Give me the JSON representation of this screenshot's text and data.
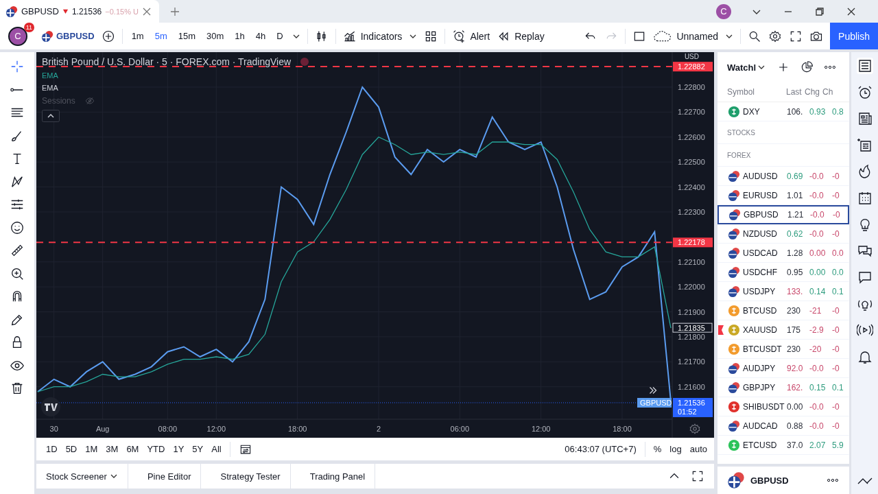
{
  "browser": {
    "tab": {
      "symbol": "GBPUSD",
      "price": "1.21536",
      "change": "−0.15% U"
    },
    "avatar": "C"
  },
  "toolbar": {
    "avatar": "C",
    "badge": "11",
    "symbol": "GBPUSD",
    "intervals": [
      {
        "label": "1m",
        "selected": false
      },
      {
        "label": "5m",
        "selected": true
      },
      {
        "label": "15m",
        "selected": false
      },
      {
        "label": "30m",
        "selected": false
      },
      {
        "label": "1h",
        "selected": false
      },
      {
        "label": "4h",
        "selected": false
      },
      {
        "label": "D",
        "selected": false
      }
    ],
    "indicators": "Indicators",
    "alert": "Alert",
    "replay": "Replay",
    "layout": "Unnamed",
    "publish": "Publish"
  },
  "chart": {
    "title": "British Pound / U.S. Dollar · 5 · FOREX.com · TradingView",
    "studies": [
      "EMA"
    ],
    "sessions": "Sessions",
    "currency": "USD",
    "chart_data": {
      "type": "line",
      "categories": [
        null,
        "30",
        null,
        null,
        "Aug",
        null,
        null,
        null,
        "08:00",
        null,
        null,
        "12:00",
        null,
        null,
        null,
        null,
        "18:00",
        null,
        null,
        null,
        null,
        "2",
        null,
        null,
        null,
        null,
        "06:00",
        null,
        null,
        null,
        null,
        "12:00",
        null,
        null,
        null,
        null,
        "18:00",
        null,
        null,
        null
      ],
      "grid": true,
      "series": [
        {
          "name": "GBPUSD",
          "color": "#5b9cf0",
          "values": [
            1.2158,
            1.2163,
            1.216,
            1.2166,
            1.217,
            1.2163,
            1.2165,
            1.2168,
            1.2174,
            1.2176,
            1.2172,
            1.2175,
            1.217,
            1.2178,
            1.2195,
            1.224,
            1.2235,
            1.2225,
            1.2245,
            1.2262,
            1.228,
            1.2272,
            1.2252,
            1.2245,
            1.2255,
            1.225,
            1.2255,
            1.2252,
            1.2268,
            1.2258,
            1.2255,
            1.2258,
            1.224,
            1.2215,
            1.2195,
            1.2198,
            1.2208,
            1.2212,
            1.2222,
            1.2154
          ]
        },
        {
          "name": "EMA",
          "color": "#26a69a",
          "values": [
            1.2158,
            1.216,
            1.216,
            1.2162,
            1.2165,
            1.2164,
            1.2164,
            1.2166,
            1.2169,
            1.2171,
            1.2171,
            1.2172,
            1.2171,
            1.2173,
            1.2181,
            1.2202,
            1.2214,
            1.2218,
            1.2227,
            1.2239,
            1.2253,
            1.226,
            1.2257,
            1.2253,
            1.2254,
            1.2253,
            1.2254,
            1.2253,
            1.2258,
            1.2258,
            1.2257,
            1.2257,
            1.2251,
            1.2238,
            1.2223,
            1.2214,
            1.2212,
            1.2212,
            1.2216,
            1.21835
          ]
        }
      ],
      "ylim": [
        1.2147,
        1.2294
      ],
      "yticks": [
        {
          "value": 1.216,
          "label": "1.21600"
        },
        {
          "value": 1.217,
          "label": "1.21700"
        },
        {
          "value": 1.218,
          "label": "1.21800"
        },
        {
          "value": 1.219,
          "label": "1.21900"
        },
        {
          "value": 1.22,
          "label": "1.22000"
        },
        {
          "value": 1.221,
          "label": "1.22100"
        },
        {
          "value": 1.223,
          "label": "1.22300"
        },
        {
          "value": 1.224,
          "label": "1.22400"
        },
        {
          "value": 1.225,
          "label": "1.22500"
        },
        {
          "value": 1.226,
          "label": "1.22600"
        },
        {
          "value": 1.227,
          "label": "1.22700"
        },
        {
          "value": 1.228,
          "label": "1.22800"
        }
      ],
      "ref_lines": [
        {
          "axis": "y",
          "value": 1.22882,
          "label": "1.22882",
          "color": "#f23645"
        },
        {
          "axis": "y",
          "value": 1.22178,
          "label": "1.22178",
          "color": "#f23645"
        },
        {
          "axis": "y",
          "value": 1.21536,
          "label": "1.21536",
          "color": "#2962ff"
        }
      ],
      "annotations": [
        "1.21835",
        "01:52"
      ]
    }
  },
  "ranges": [
    "1D",
    "5D",
    "1M",
    "3M",
    "6M",
    "YTD",
    "1Y",
    "5Y",
    "All"
  ],
  "clock": "06:43:07 (UTC+7)",
  "scale_options": [
    "%",
    "log",
    "auto"
  ],
  "bottom_tabs": [
    {
      "label": "Stock Screener",
      "dropdown": true
    },
    {
      "label": "Pine Editor",
      "dropdown": false
    },
    {
      "label": "Strategy Tester",
      "dropdown": false
    },
    {
      "label": "Trading Panel",
      "dropdown": false
    }
  ],
  "watchlist": {
    "title": "Watchl",
    "columns": [
      "Symbol",
      "Last",
      "Chg",
      "Ch"
    ],
    "items": [
      {
        "kind": "coin",
        "color": "#1e9e6b",
        "symbol": "DXY",
        "last": {
          "text": "106.",
          "color": "#2a2e39"
        },
        "chg": {
          "text": "0.93",
          "color": "#2e9c7e"
        },
        "chgp": {
          "text": "0.8",
          "color": "#2e9c7e"
        },
        "selected": false,
        "flagged": false
      },
      {
        "kind": "section",
        "label": "STOCKS"
      },
      {
        "kind": "section",
        "label": "FOREX"
      },
      {
        "kind": "pair",
        "symbol": "AUDUSD",
        "last": {
          "text": "0.69",
          "color": "#2e9c7e"
        },
        "chg": {
          "text": "-0.0",
          "color": "#c8476a"
        },
        "chgp": {
          "text": "-0",
          "color": "#c8476a"
        },
        "selected": false,
        "flagged": false
      },
      {
        "kind": "pair",
        "symbol": "EURUSD",
        "last": {
          "text": "1.01",
          "color": "#2a2e39"
        },
        "chg": {
          "text": "-0.0",
          "color": "#c8476a"
        },
        "chgp": {
          "text": "-0",
          "color": "#c8476a"
        },
        "selected": false,
        "flagged": false
      },
      {
        "kind": "pair",
        "symbol": "GBPUSD",
        "last": {
          "text": "1.21",
          "color": "#2a2e39"
        },
        "chg": {
          "text": "-0.0",
          "color": "#c8476a"
        },
        "chgp": {
          "text": "-0",
          "color": "#c8476a"
        },
        "selected": true,
        "flagged": false
      },
      {
        "kind": "pair",
        "symbol": "NZDUSD",
        "last": {
          "text": "0.62",
          "color": "#2e9c7e"
        },
        "chg": {
          "text": "-0.0",
          "color": "#c8476a"
        },
        "chgp": {
          "text": "-0",
          "color": "#c8476a"
        },
        "selected": false,
        "flagged": false
      },
      {
        "kind": "pair",
        "symbol": "USDCAD",
        "last": {
          "text": "1.28",
          "color": "#2a2e39"
        },
        "chg": {
          "text": "0.00",
          "color": "#c8476a"
        },
        "chgp": {
          "text": "0.0",
          "color": "#c8476a"
        },
        "selected": false,
        "flagged": false
      },
      {
        "kind": "pair",
        "symbol": "USDCHF",
        "last": {
          "text": "0.95",
          "color": "#2a2e39"
        },
        "chg": {
          "text": "0.00",
          "color": "#2e9c7e"
        },
        "chgp": {
          "text": "0.0",
          "color": "#2e9c7e"
        },
        "selected": false,
        "flagged": false
      },
      {
        "kind": "pair",
        "symbol": "USDJPY",
        "last": {
          "text": "133.",
          "color": "#c8476a"
        },
        "chg": {
          "text": "0.14",
          "color": "#2e9c7e"
        },
        "chgp": {
          "text": "0.1",
          "color": "#2e9c7e"
        },
        "selected": false,
        "flagged": false
      },
      {
        "kind": "coin",
        "color": "#f29b2d",
        "symbol": "BTCUSD",
        "last": {
          "text": "230",
          "color": "#2a2e39"
        },
        "chg": {
          "text": "-21",
          "color": "#c8476a"
        },
        "chgp": {
          "text": "-0",
          "color": "#c8476a"
        },
        "selected": false,
        "flagged": false
      },
      {
        "kind": "coin",
        "color": "#c9a825",
        "symbol": "XAUUSD",
        "last": {
          "text": "175",
          "color": "#2a2e39"
        },
        "chg": {
          "text": "-2.9",
          "color": "#c8476a"
        },
        "chgp": {
          "text": "-0",
          "color": "#c8476a"
        },
        "selected": false,
        "flagged": true
      },
      {
        "kind": "coin",
        "color": "#f29b2d",
        "symbol": "BTCUSDT",
        "last": {
          "text": "230",
          "color": "#2a2e39"
        },
        "chg": {
          "text": "-20",
          "color": "#c8476a"
        },
        "chgp": {
          "text": "-0",
          "color": "#c8476a"
        },
        "selected": false,
        "flagged": false
      },
      {
        "kind": "pair",
        "symbol": "AUDJPY",
        "last": {
          "text": "92.0",
          "color": "#c8476a"
        },
        "chg": {
          "text": "-0.0",
          "color": "#c8476a"
        },
        "chgp": {
          "text": "-0",
          "color": "#c8476a"
        },
        "selected": false,
        "flagged": false
      },
      {
        "kind": "pair",
        "symbol": "GBPJPY",
        "last": {
          "text": "162.",
          "color": "#c8476a"
        },
        "chg": {
          "text": "0.15",
          "color": "#2e9c7e"
        },
        "chgp": {
          "text": "0.1",
          "color": "#2e9c7e"
        },
        "selected": false,
        "flagged": false
      },
      {
        "kind": "coin",
        "color": "#e0302c",
        "symbol": "SHIBUSDT",
        "last": {
          "text": "0.00",
          "color": "#2a2e39"
        },
        "chg": {
          "text": "-0.0",
          "color": "#c8476a"
        },
        "chgp": {
          "text": "-0",
          "color": "#c8476a"
        },
        "selected": false,
        "flagged": false
      },
      {
        "kind": "pair",
        "symbol": "AUDCAD",
        "last": {
          "text": "0.88",
          "color": "#2a2e39"
        },
        "chg": {
          "text": "-0.0",
          "color": "#c8476a"
        },
        "chgp": {
          "text": "-0",
          "color": "#c8476a"
        },
        "selected": false,
        "flagged": false
      },
      {
        "kind": "coin",
        "color": "#2cc35a",
        "symbol": "ETCUSD",
        "last": {
          "text": "37.0",
          "color": "#2a2e39"
        },
        "chg": {
          "text": "2.07",
          "color": "#2e9c7e"
        },
        "chgp": {
          "text": "5.9",
          "color": "#2e9c7e"
        },
        "selected": false,
        "flagged": false
      }
    ],
    "detail": {
      "symbol": "GBPUSD"
    }
  }
}
